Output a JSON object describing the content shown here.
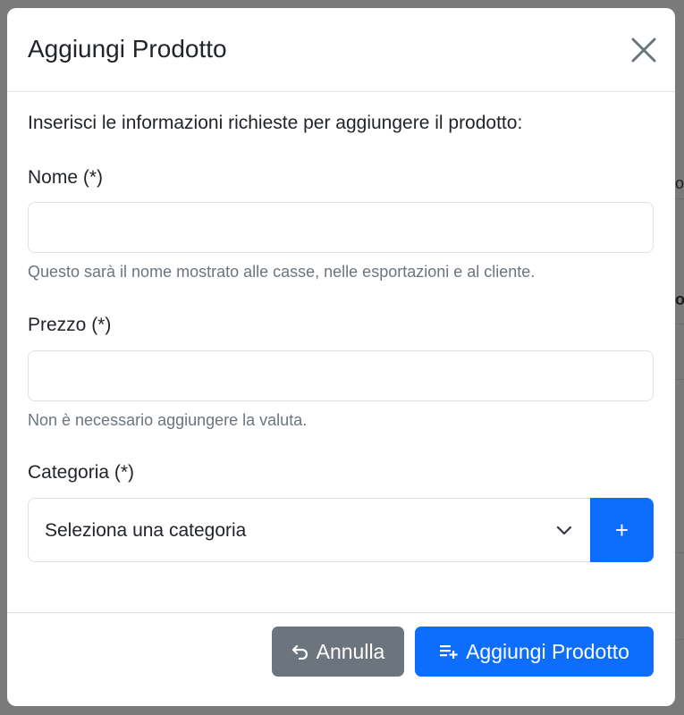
{
  "modal": {
    "title": "Aggiungi Prodotto",
    "intro": "Inserisci le informazioni richieste per aggiungere il prodotto:"
  },
  "fields": {
    "name": {
      "label": "Nome (*)",
      "value": "",
      "help": "Questo sarà il nome mostrato alle casse, nelle esportazioni e al cliente."
    },
    "price": {
      "label": "Prezzo (*)",
      "value": "",
      "help": "Non è necessario aggiungere la valuta."
    },
    "category": {
      "label": "Categoria (*)",
      "selected": "Seleziona una categoria",
      "add_label": "+"
    }
  },
  "footer": {
    "cancel_label": "Annulla",
    "add_label": "Aggiungi Prodotto"
  },
  "background": {
    "edge_text_1": "o",
    "edge_text_2": "o"
  },
  "colors": {
    "primary": "#0d6efd",
    "secondary": "#6c757d",
    "backdrop": "#7a7a7a"
  }
}
